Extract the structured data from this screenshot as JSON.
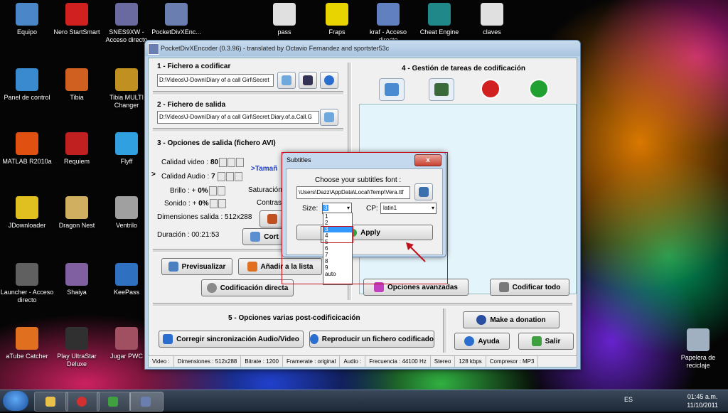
{
  "desktop_icons": [
    {
      "label": "Equipo",
      "color": "#4a86c8"
    },
    {
      "label": "Nero StartSmart",
      "color": "#d02020"
    },
    {
      "label": "SNES9XW - Acceso directo",
      "color": "#6a6aa0"
    },
    {
      "label": "PocketDivXEnc...",
      "color": "#6a7fb0"
    },
    {
      "label": "pass",
      "color": "#e0e0e0"
    },
    {
      "label": "Fraps",
      "color": "#e8d400"
    },
    {
      "label": "kraf - Acceso directo",
      "color": "#6080c0"
    },
    {
      "label": "Cheat Engine",
      "color": "#208888"
    },
    {
      "label": "claves",
      "color": "#e0e0e0"
    },
    {
      "label": "Panel de control",
      "color": "#3a8ad0"
    },
    {
      "label": "Tibia",
      "color": "#d06020"
    },
    {
      "label": "Tibia MULTI Changer",
      "color": "#c09020"
    },
    {
      "label": "MATLAB R2010a",
      "color": "#e05010"
    },
    {
      "label": "Requiem",
      "color": "#c02020"
    },
    {
      "label": "Flyff",
      "color": "#30a0e0"
    },
    {
      "label": "JDownloader",
      "color": "#e0c020"
    },
    {
      "label": "Dragon Nest",
      "color": "#d0b060"
    },
    {
      "label": "Ventrilo",
      "color": "#a0a0a0"
    },
    {
      "label": "Launcher - Acceso directo",
      "color": "#606060"
    },
    {
      "label": "Shaiya",
      "color": "#8060a0"
    },
    {
      "label": "KeePass",
      "color": "#3070c0"
    },
    {
      "label": "aTube Catcher",
      "color": "#e07020"
    },
    {
      "label": "Play UltraStar Deluxe",
      "color": "#303030"
    },
    {
      "label": "Jugar PWC",
      "color": "#a05060"
    },
    {
      "label": "Papelera de reciclaje",
      "color": "#a0b0c0"
    }
  ],
  "window": {
    "title": "PocketDivXEncoder (0.3.96) - translated by Octavio Fernandez and sportster53c",
    "sections": {
      "s1": "1 - Fichero a codificar",
      "s2": "2 - Fichero de salida",
      "s3": "3 - Opciones de salida (fichero AVI)",
      "s4": "4 - Gestión de tareas de codificación",
      "s5": "5 - Opciones varias post-codificicación"
    },
    "input_path": "D:\\Videos\\J-Down\\Diary of a call Girl\\Secret",
    "output_path": "D:\\Videos\\J-Down\\Diary of a call Girl\\Secret.Diary.of.a.Call.G",
    "options": {
      "calidad_video_label": "Calidad video :",
      "calidad_video_value": "80",
      "calidad_audio_label": "Calidad Audio :",
      "calidad_audio_value": "7",
      "tamano": ">Tamañ",
      "brillo_label": "Brillo : +",
      "brillo_value": "0%",
      "saturacion": "Saturación",
      "sonido_label": "Sonido : +",
      "sonido_value": "0%",
      "contraste": "Contras",
      "dimensiones": "Dimensiones salida : 512x288",
      "duracion": "Duración : 00:21:53",
      "cort_label": "Cort"
    },
    "buttons": {
      "previsualizar": "Previsualizar",
      "anadir": "Añadir a la lista",
      "codificacion_directa": "Codificación directa",
      "opciones_avanzadas": "Opciones avanzadas",
      "codificar_todo": "Codificar todo",
      "corregir": "Corregir sincronización Audio/Video",
      "reproducir": "Reproducir un fichero codificado",
      "donation": "Make a donation",
      "ayuda": "Ayuda",
      "salir": "Salir"
    },
    "status": [
      "Video :",
      "Dimensiones : 512x288",
      "Bitrate : 1200",
      "Framerate : original",
      "Audio :",
      "Frecuencia : 44100 Hz",
      "Stereo",
      "128 kbps",
      "Compresor : MP3"
    ]
  },
  "dialog": {
    "title": "Subtitles",
    "choose_label": "Choose your subtitles font :",
    "font_path": "\\Users\\Dazz\\AppData\\Local\\Temp\\Vera.ttf",
    "size_label": "Size:",
    "size_value": "3",
    "cp_label": "CP:",
    "cp_value": "latin1",
    "apply_label": "Apply",
    "size_options": [
      "1",
      "2",
      "3",
      "4",
      "5",
      "6",
      "7",
      "8",
      "9",
      "auto"
    ],
    "close": "x"
  },
  "taskbar": {
    "lang": "ES",
    "time": "01:45 a.m.",
    "date": "11/10/2011"
  }
}
